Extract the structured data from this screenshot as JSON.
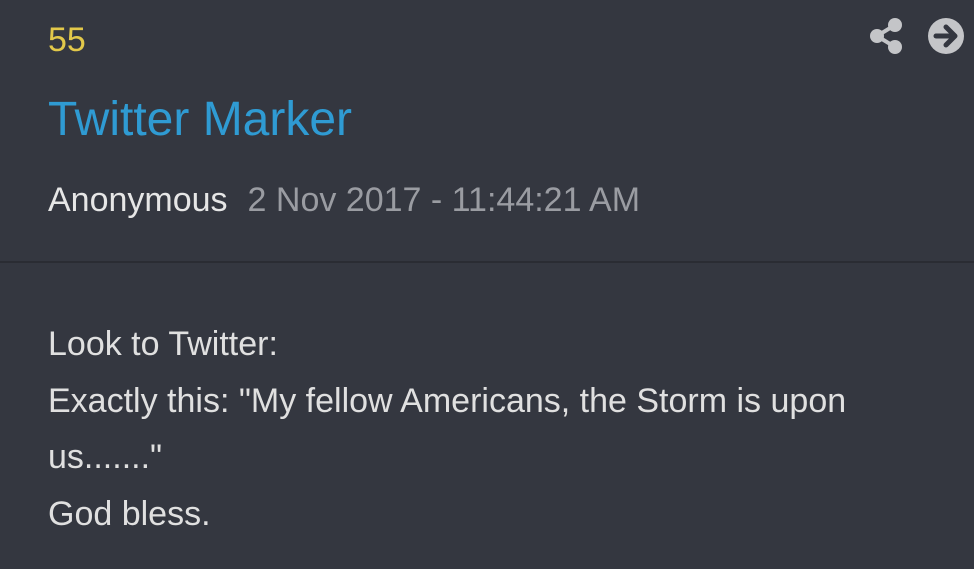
{
  "post": {
    "number": "55",
    "title": "Twitter Marker",
    "author": "Anonymous",
    "timestamp": "2 Nov 2017 - 11:44:21 AM",
    "body_lines": [
      "Look to Twitter:",
      "Exactly this: \"My fellow Americans, the Storm is upon us.......\"",
      "God bless."
    ]
  },
  "actions": {
    "share_icon": "share-icon",
    "open_icon": "arrow-right-circle-icon"
  },
  "colors": {
    "background": "#343740",
    "number": "#e2c84a",
    "title": "#2f9bd3",
    "author": "#e6e6e6",
    "timestamp": "#9a9ca2",
    "body": "#e0e0e0",
    "icon": "#c4c5c8"
  }
}
